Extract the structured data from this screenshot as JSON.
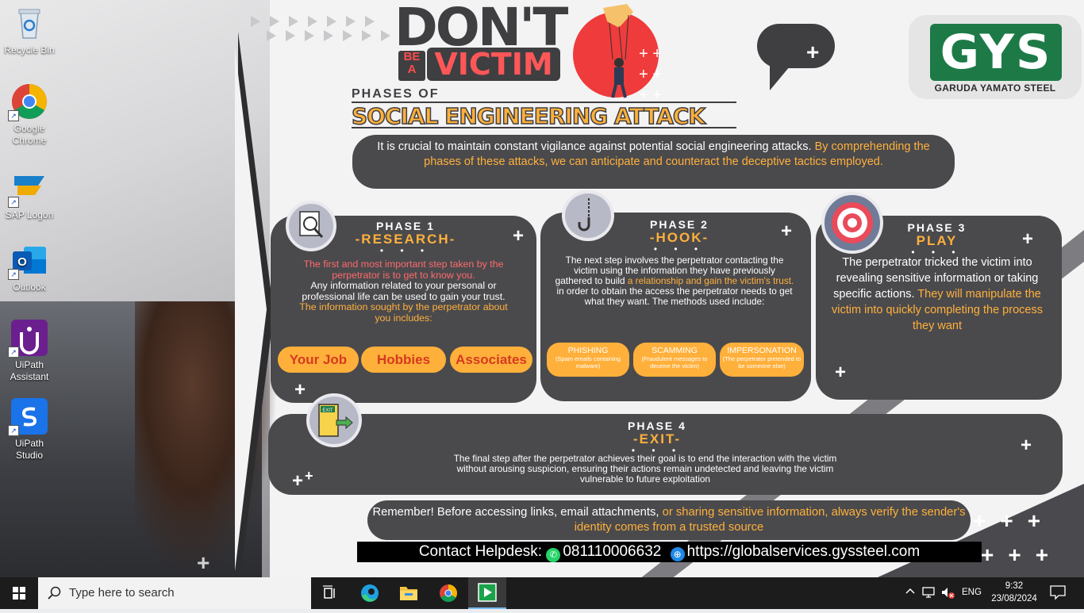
{
  "desktop": {
    "icons": [
      {
        "label": "Recycle Bin",
        "icon": "recycle-bin-icon"
      },
      {
        "label": "Google Chrome",
        "icon": "chrome-icon"
      },
      {
        "label": "SAP Logon",
        "icon": "sap-logon-icon"
      },
      {
        "label": "Outlook",
        "icon": "outlook-icon"
      },
      {
        "label": "UiPath Assistant",
        "icon": "uipath-assistant-icon"
      },
      {
        "label": "UiPath Studio",
        "icon": "uipath-studio-icon"
      }
    ]
  },
  "poster": {
    "dont": "DON'T",
    "be": "BE",
    "a": "A",
    "victim": "VICTIM",
    "phases_of": "PHASES OF",
    "title": "SOCIAL ENGINEERING ATTACK",
    "intro_plain": "It is crucial to maintain constant vigilance against potential social engineering attacks.",
    "intro_highlight": "By comprehending the phases of these attacks, we can anticipate and counteract the deceptive tactics employed.",
    "logo_letters": "GYS",
    "logo_name": "GARUDA YAMATO STEEL",
    "phase1": {
      "label": "PHASE 1",
      "name": "-RESEARCH-",
      "lead": "The first and most important step taken by the perpetrator is to get to know you.",
      "body": "Any information related to your personal or professional life can be used to gain your trust.",
      "sought": "The information sought by the perpetrator about you includes:",
      "items": [
        "Your Job",
        "Hobbies",
        "Associates"
      ]
    },
    "phase2": {
      "label": "PHASE 2",
      "name": "-HOOK-",
      "body_a": "The next step involves the perpetrator contacting the victim using the information they have previously gathered to build",
      "body_highlight": "a relationship and gain the victim's trust.",
      "body_b": "in order to obtain the access the perpetrator needs to get what they want. The methods used include:",
      "methods": [
        {
          "title": "PHISHING",
          "desc": "(Spam emails containing malware)"
        },
        {
          "title": "SCAMMING",
          "desc": "(Fraudulent messages to deceive the victim)"
        },
        {
          "title": "IMPERSONATION",
          "desc": "(The perpetrator pretended to be someone else)"
        }
      ]
    },
    "phase3": {
      "label": "PHASE 3",
      "name": "PLAY",
      "body": "The perpetrator tricked the victim into revealing sensitive information or taking specific actions.",
      "highlight": "They will manipulate the victim into quickly completing the process they want"
    },
    "phase4": {
      "label": "PHASE 4",
      "name": "-EXIT-",
      "body": "The final step after the perpetrator achieves their goal is to end the interaction with the victim without arousing suspicion, ensuring their actions remain undetected and leaving the victim vulnerable to future exploitation"
    },
    "remember_plain": "Remember! Before accessing links, email attachments,",
    "remember_highlight": "or sharing sensitive information, always verify the sender's identity comes from a trusted source",
    "helpdesk_label": "Contact Helpdesk:",
    "helpdesk_phone": "081110006632",
    "helpdesk_url": "https://globalservices.gyssteel.com",
    "exit_sign": "EXIT"
  },
  "taskbar": {
    "search_placeholder": "Type here to search",
    "apps": [
      "task-view-icon",
      "edge-icon",
      "file-explorer-icon",
      "chrome-icon",
      "media-player-icon"
    ],
    "language": "ENG",
    "time": "9:32",
    "date": "23/08/2024"
  },
  "colors": {
    "accent_orange": "#ffb03b",
    "accent_red": "#ff5757",
    "card_bg": "#4a4a4d",
    "brand_green": "#1d7a46"
  }
}
